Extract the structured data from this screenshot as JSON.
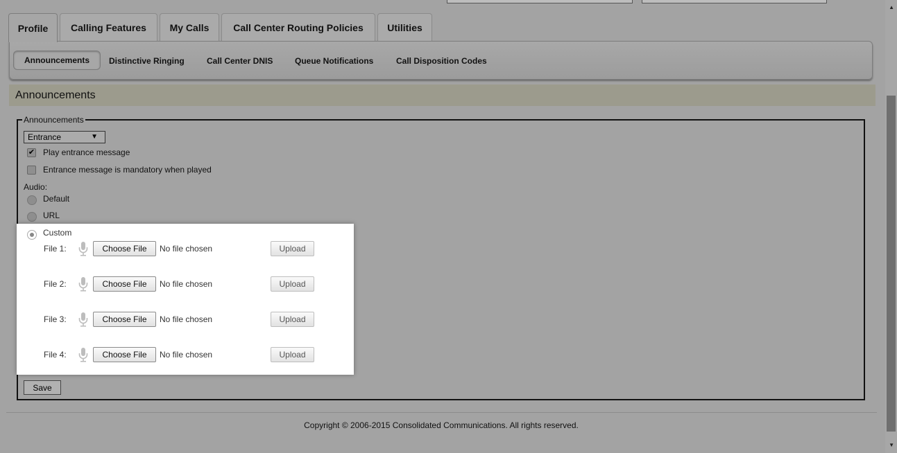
{
  "tabs": [
    "Profile",
    "Calling Features",
    "My Calls",
    "Call Center Routing Policies",
    "Utilities"
  ],
  "subnav": [
    "Announcements",
    "Distinctive Ringing",
    "Call Center DNIS",
    "Queue Notifications",
    "Call Disposition Codes"
  ],
  "section_title": "Announcements",
  "fieldset_legend": "Announcements",
  "announcement_type": {
    "selected": "Entrance",
    "arrow": "▼"
  },
  "checkboxes": {
    "play_entrance": {
      "label": "Play entrance message",
      "checked": true,
      "mark": "✔"
    },
    "mandatory": {
      "label": "Entrance message is mandatory when played",
      "checked": false
    }
  },
  "audio": {
    "label": "Audio:",
    "options": [
      "Default",
      "URL",
      "Custom"
    ],
    "selected": "Custom"
  },
  "files": [
    {
      "label": "File 1:",
      "choose": "Choose File",
      "status": "No file chosen",
      "upload": "Upload"
    },
    {
      "label": "File 2:",
      "choose": "Choose File",
      "status": "No file chosen",
      "upload": "Upload"
    },
    {
      "label": "File 3:",
      "choose": "Choose File",
      "status": "No file chosen",
      "upload": "Upload"
    },
    {
      "label": "File 4:",
      "choose": "Choose File",
      "status": "No file chosen",
      "upload": "Upload"
    }
  ],
  "save_label": "Save",
  "footer": "Copyright © 2006-2015 Consolidated Communications. All rights reserved.",
  "scroll": {
    "up": "▲",
    "down": "▼"
  },
  "colors": {
    "page_bg": "#a3a3a3",
    "section_bar": "#9c9b8d",
    "highlight": "#ffffff"
  }
}
